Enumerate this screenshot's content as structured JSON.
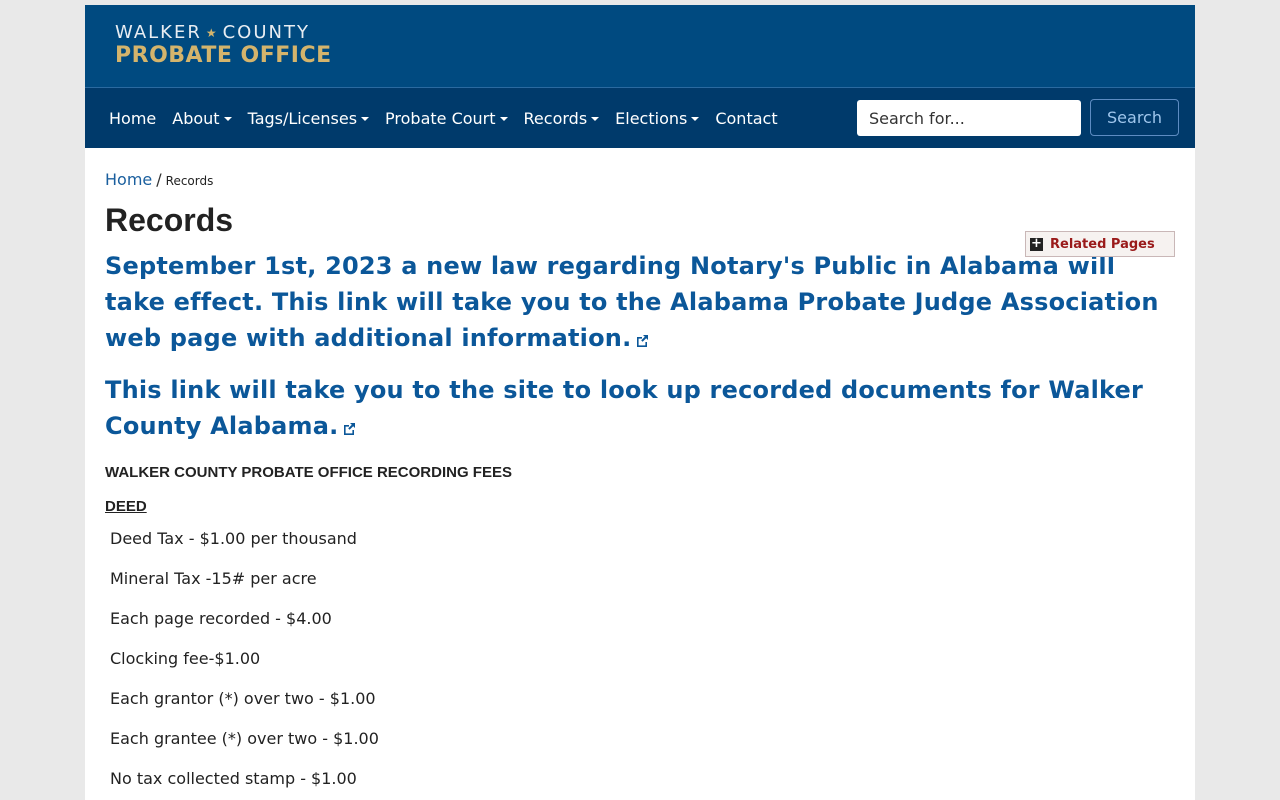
{
  "logo": {
    "line1_left": "WALKER",
    "line1_right": "COUNTY",
    "line2": "PROBATE OFFICE"
  },
  "nav": {
    "items": [
      {
        "label": "Home",
        "dropdown": false
      },
      {
        "label": "About",
        "dropdown": true
      },
      {
        "label": "Tags/Licenses",
        "dropdown": true
      },
      {
        "label": "Probate Court",
        "dropdown": true
      },
      {
        "label": "Records",
        "dropdown": true
      },
      {
        "label": "Elections",
        "dropdown": true
      },
      {
        "label": "Contact",
        "dropdown": false
      }
    ],
    "search_placeholder": "Search for...",
    "search_button": "Search"
  },
  "breadcrumb": {
    "home": "Home",
    "separator": "/",
    "current": "Records"
  },
  "page_title": "Records",
  "related_pages": "Related Pages",
  "notices": [
    "September 1st, 2023 a new law regarding Notary's Public in Alabama will take effect. This link will take you to the Alabama Probate Judge Association web page with additional information.",
    "This link will take you to the site to look up recorded documents for Walker County Alabama."
  ],
  "fees_header": "WALKER COUNTY PROBATE OFFICE RECORDING FEES",
  "deed_header": "DEED",
  "fees": [
    "Deed Tax - $1.00 per thousand",
    "Mineral Tax -15# per acre",
    "Each page recorded - $4.00",
    "Clocking fee-$1.00",
    "Each grantor (*) over two - $1.00",
    "Each grantee (*) over two - $1.00",
    "No tax collected stamp - $1.00"
  ],
  "colors": {
    "header_bg": "#004a80",
    "nav_bg": "#003a6b",
    "logo_gold": "#d4b46c",
    "link_blue": "#0b5799"
  }
}
